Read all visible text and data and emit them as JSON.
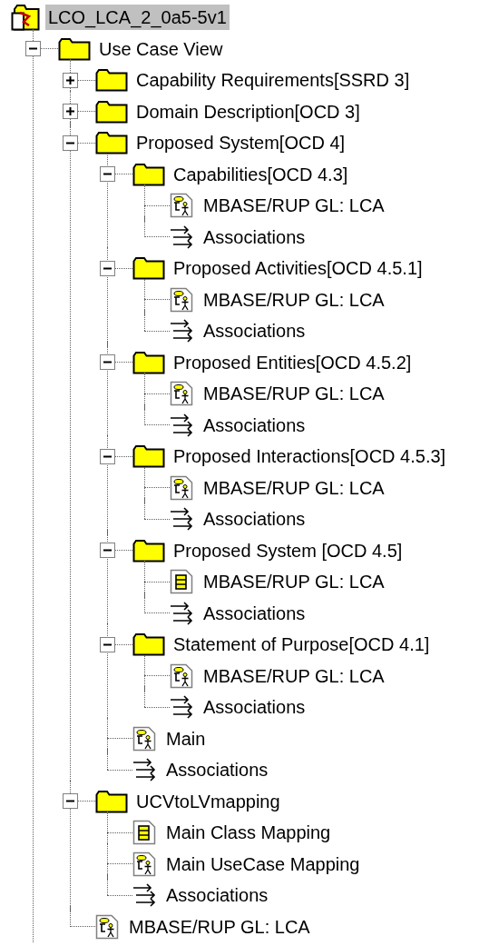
{
  "tree": {
    "root": {
      "kind": "model",
      "label": "LCO_LCA_2_0a5-5v1",
      "selected": true,
      "children": [
        {
          "kind": "package",
          "label": "Use Case View",
          "expanded": true,
          "selected": false,
          "children": [
            {
              "kind": "package",
              "label": "Capability Requirements[SSRD 3]",
              "expanded": false,
              "selected": false
            },
            {
              "kind": "package",
              "label": "Domain Description[OCD 3]",
              "expanded": false,
              "selected": false
            },
            {
              "kind": "package",
              "label": "Proposed System[OCD 4]",
              "expanded": true,
              "selected": false,
              "children": [
                {
                  "kind": "package",
                  "label": "Capabilities[OCD 4.3]",
                  "expanded": true,
                  "selected": false,
                  "children": [
                    {
                      "kind": "usecase-diagram",
                      "label": "MBASE/RUP GL: LCA",
                      "selected": false
                    },
                    {
                      "kind": "associations",
                      "label": "Associations",
                      "selected": false
                    }
                  ]
                },
                {
                  "kind": "package",
                  "label": "Proposed Activities[OCD 4.5.1]",
                  "expanded": true,
                  "selected": false,
                  "children": [
                    {
                      "kind": "usecase-diagram",
                      "label": "MBASE/RUP GL: LCA",
                      "selected": false
                    },
                    {
                      "kind": "associations",
                      "label": "Associations",
                      "selected": false
                    }
                  ]
                },
                {
                  "kind": "package",
                  "label": "Proposed Entities[OCD 4.5.2]",
                  "expanded": true,
                  "selected": false,
                  "children": [
                    {
                      "kind": "usecase-diagram",
                      "label": "MBASE/RUP GL: LCA",
                      "selected": false
                    },
                    {
                      "kind": "associations",
                      "label": "Associations",
                      "selected": false
                    }
                  ]
                },
                {
                  "kind": "package",
                  "label": "Proposed Interactions[OCD 4.5.3]",
                  "expanded": true,
                  "selected": false,
                  "children": [
                    {
                      "kind": "usecase-diagram",
                      "label": "MBASE/RUP GL: LCA",
                      "selected": false
                    },
                    {
                      "kind": "associations",
                      "label": "Associations",
                      "selected": false
                    }
                  ]
                },
                {
                  "kind": "package",
                  "label": "Proposed System [OCD 4.5]",
                  "expanded": true,
                  "selected": false,
                  "children": [
                    {
                      "kind": "class-diagram",
                      "label": "MBASE/RUP GL: LCA",
                      "selected": false
                    },
                    {
                      "kind": "associations",
                      "label": "Associations",
                      "selected": false
                    }
                  ]
                },
                {
                  "kind": "package",
                  "label": "Statement of Purpose[OCD 4.1]",
                  "expanded": true,
                  "selected": false,
                  "children": [
                    {
                      "kind": "usecase-diagram",
                      "label": "MBASE/RUP GL: LCA",
                      "selected": false
                    },
                    {
                      "kind": "associations",
                      "label": "Associations",
                      "selected": false
                    }
                  ]
                },
                {
                  "kind": "usecase-diagram",
                  "label": "Main",
                  "selected": false
                },
                {
                  "kind": "associations",
                  "label": "Associations",
                  "selected": false
                }
              ]
            },
            {
              "kind": "package",
              "label": "UCVtoLVmapping",
              "expanded": true,
              "selected": false,
              "children": [
                {
                  "kind": "class-diagram",
                  "label": "Main Class Mapping",
                  "selected": false
                },
                {
                  "kind": "usecase-diagram",
                  "label": "Main UseCase Mapping",
                  "selected": false
                },
                {
                  "kind": "associations",
                  "label": "Associations",
                  "selected": false
                }
              ]
            },
            {
              "kind": "usecase-diagram",
              "label": "MBASE/RUP GL: LCA",
              "selected": false
            }
          ]
        }
      ]
    }
  }
}
